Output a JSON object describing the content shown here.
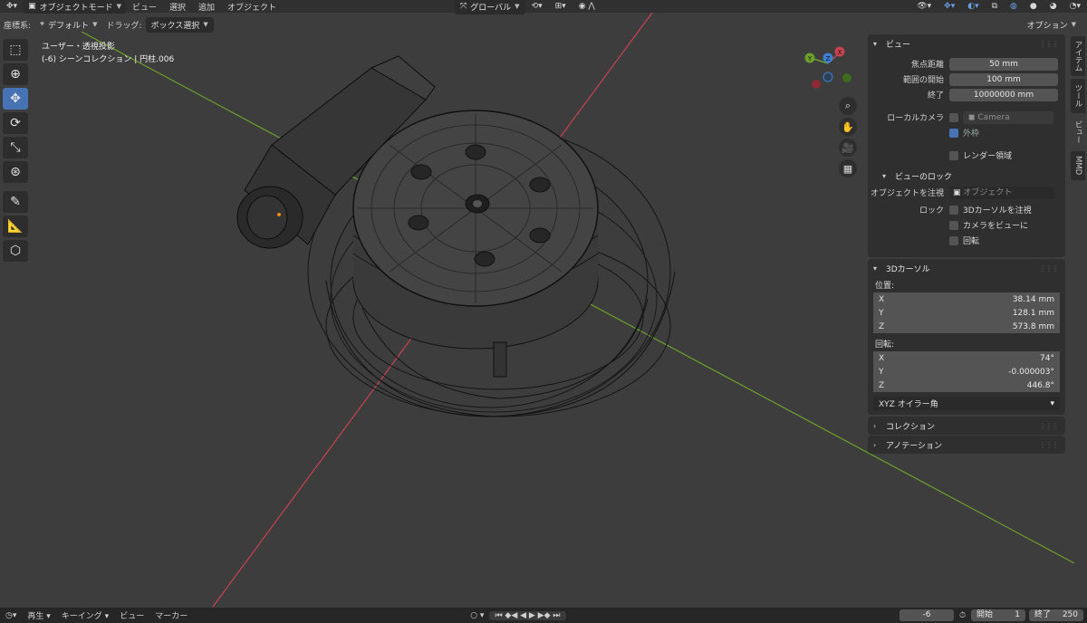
{
  "header": {
    "menus": [
      "オブジェクトモード",
      "ビュー",
      "選択",
      "追加",
      "オブジェクト"
    ],
    "transform_orientation": "グローバル",
    "options_label": "オプション"
  },
  "subheader": {
    "coord_label": "座標系:",
    "coord_value": "デフォルト",
    "drag_label": "ドラッグ:",
    "drag_value": "ボックス選択"
  },
  "toolbar": {
    "tools": [
      "select-box",
      "cursor",
      "move",
      "rotate",
      "scale",
      "transform",
      "annotate",
      "measure",
      "add-cube"
    ],
    "active": "move"
  },
  "viewport": {
    "title": "ユーザー・透視投影",
    "subtitle": "(-6) シーンコレクション | 円柱.006",
    "gizmo": {
      "x": "X",
      "y": "Y",
      "z": "Z"
    }
  },
  "npanel": {
    "view": {
      "header": "ビュー",
      "focal_length_label": "焦点距離",
      "focal_length": "50 mm",
      "clip_start_label": "範囲の開始",
      "clip_start": "100 mm",
      "clip_end_label": "終了",
      "clip_end": "10000000 mm",
      "local_camera_label": "ローカルカメラ",
      "camera_value": "Camera",
      "outer_frame_label": "外枠",
      "render_region_label": "レンダー領域"
    },
    "view_lock": {
      "header": "ビューのロック",
      "lock_object_label": "オブジェクトを注視",
      "lock_object_placeholder": "オブジェクト",
      "lock_label": "ロック",
      "lock_cursor_label": "3Dカーソルを注視",
      "camera_to_view_label": "カメラをビューに",
      "rotation_label": "回転"
    },
    "cursor": {
      "header": "3Dカーソル",
      "location_label": "位置:",
      "loc": [
        {
          "axis": "X",
          "value": "38.14 mm"
        },
        {
          "axis": "Y",
          "value": "128.1 mm"
        },
        {
          "axis": "Z",
          "value": "573.8 mm"
        }
      ],
      "rotation_label": "回転:",
      "rot": [
        {
          "axis": "X",
          "value": "74°"
        },
        {
          "axis": "Y",
          "value": "-0.000003°"
        },
        {
          "axis": "Z",
          "value": "446.8°"
        }
      ],
      "rotation_mode": "XYZ オイラー角"
    },
    "collection_header": "コレクション",
    "annotation_header": "アノテーション"
  },
  "tabs": [
    "アイテム",
    "ツール",
    "ビュー",
    "MMD"
  ],
  "timeline": {
    "menus": [
      "再生",
      "キーイング",
      "ビュー",
      "マーカー"
    ],
    "current_frame": "-6",
    "start_label": "開始",
    "start": "1",
    "end_label": "終了",
    "end": "250"
  },
  "colors": {
    "accent": "#4772b3",
    "x_axis": "#c7434f",
    "y_axis": "#6ca02a",
    "z_axis": "#3c80d2"
  }
}
